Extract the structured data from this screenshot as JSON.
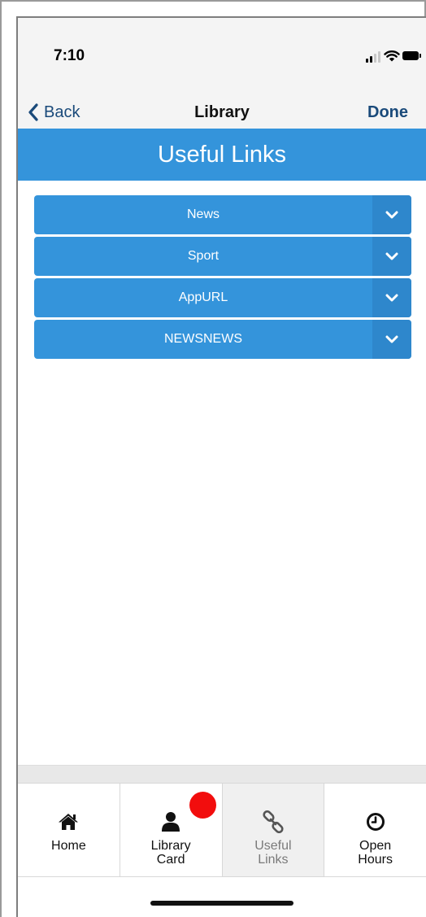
{
  "status_bar": {
    "time": "7:10",
    "signal_icon": "signal-bars-icon",
    "wifi_icon": "wifi-icon",
    "battery_icon": "battery-icon"
  },
  "nav_bar": {
    "back_label": "Back",
    "back_icon": "chevron-left-icon",
    "title": "Library",
    "done_label": "Done"
  },
  "page": {
    "title": "Useful Links"
  },
  "links": [
    {
      "label": "News",
      "icon": "chevron-down-icon"
    },
    {
      "label": "Sport",
      "icon": "chevron-down-icon"
    },
    {
      "label": "AppURL",
      "icon": "chevron-down-icon"
    },
    {
      "label": "NEWSNEWS",
      "icon": "chevron-down-icon"
    }
  ],
  "tabbar": {
    "tabs": [
      {
        "label": "Home",
        "icon": "home-icon",
        "active": false
      },
      {
        "label": "Library\nCard",
        "icon": "user-icon",
        "active": false,
        "badge": true
      },
      {
        "label": "Useful\nLinks",
        "icon": "link-icon",
        "active": true
      },
      {
        "label": "Open\nHours",
        "icon": "clock-icon",
        "active": false
      }
    ]
  },
  "colors": {
    "accent": "#3494db",
    "accent_dark": "#2e87cc",
    "nav_text": "#1a4a7a",
    "badge": "#f20d0d",
    "bar_background": "#f4f4f4"
  }
}
